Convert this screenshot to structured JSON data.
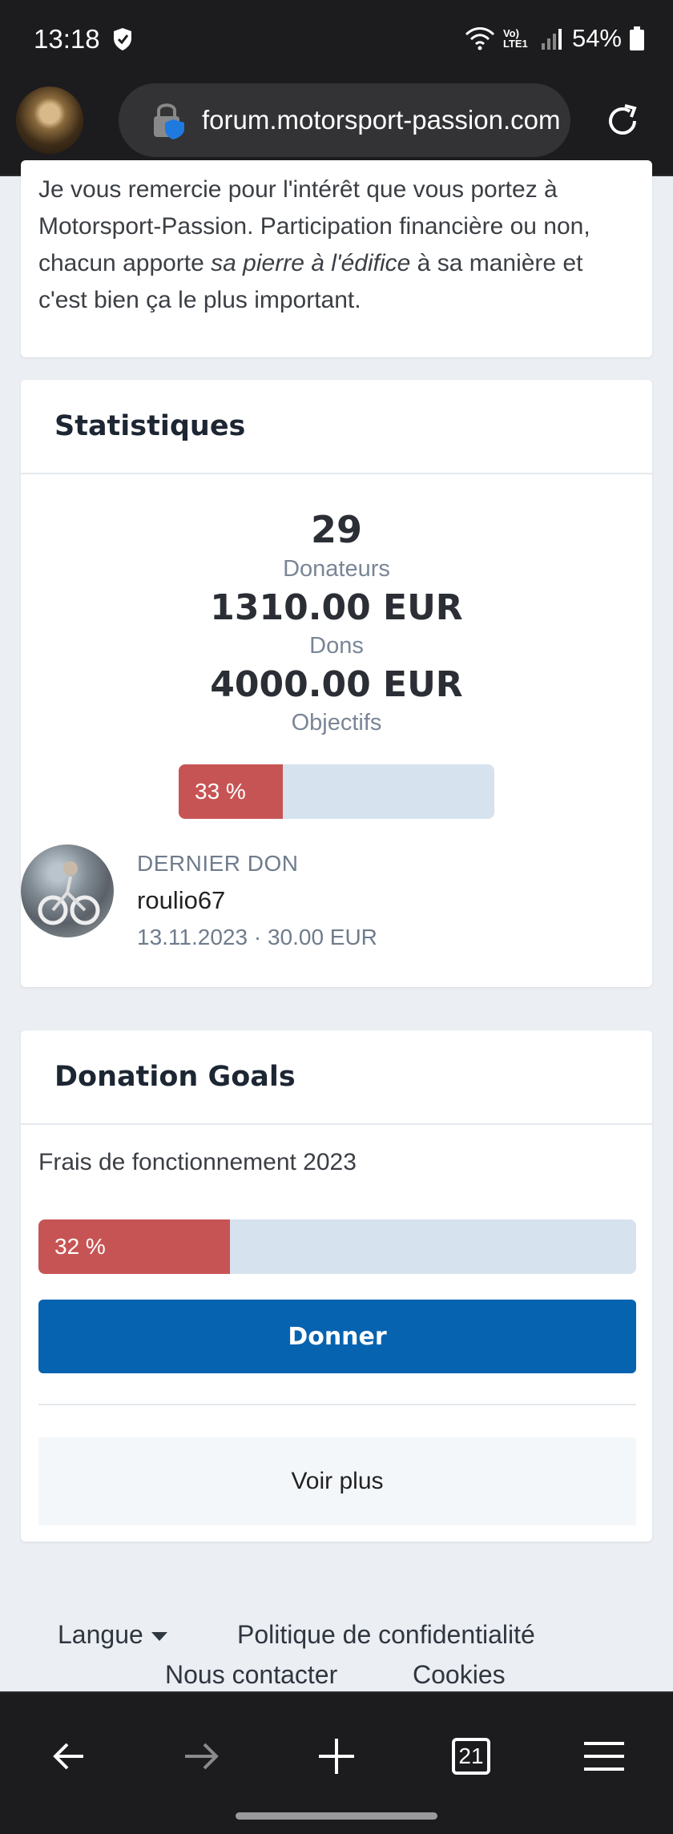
{
  "status_bar": {
    "time": "13:18",
    "network": "Vo) LTE1",
    "battery": "54%"
  },
  "browser": {
    "url": "forum.motorsport-passion.com"
  },
  "intro": {
    "text_before": "Je vous remercie pour l'intérêt que vous portez à Motorsport-Passion. Participation financière ou non, chacun apporte ",
    "text_em": "sa pierre à l'édifice",
    "text_after": " à sa manière et c'est bien ça le plus important."
  },
  "stats": {
    "title": "Statistiques",
    "donors_count": "29",
    "donors_label": "Donateurs",
    "donations_amount": "1310.00 EUR",
    "donations_label": "Dons",
    "goal_amount": "4000.00 EUR",
    "goal_label": "Objectifs",
    "progress_label": "33  %",
    "progress_fraction": 0.33,
    "last_donation": {
      "label": "DERNIER DON",
      "user": "roulio67",
      "meta": "13.11.2023 · 30.00 EUR"
    }
  },
  "goals": {
    "title": "Donation Goals",
    "goal_name": "Frais de fonctionnement 2023",
    "progress_label": "32  %",
    "progress_fraction": 0.32,
    "donate_label": "Donner",
    "more_label": "Voir plus"
  },
  "footer": {
    "language": "Langue",
    "privacy": "Politique de confidentialité",
    "contact": "Nous contacter",
    "cookies": "Cookies"
  },
  "nav": {
    "tabs_count": "21"
  },
  "colors": {
    "accent": "#0563b0",
    "progress": "#c75454",
    "track": "#d6e2ee"
  }
}
